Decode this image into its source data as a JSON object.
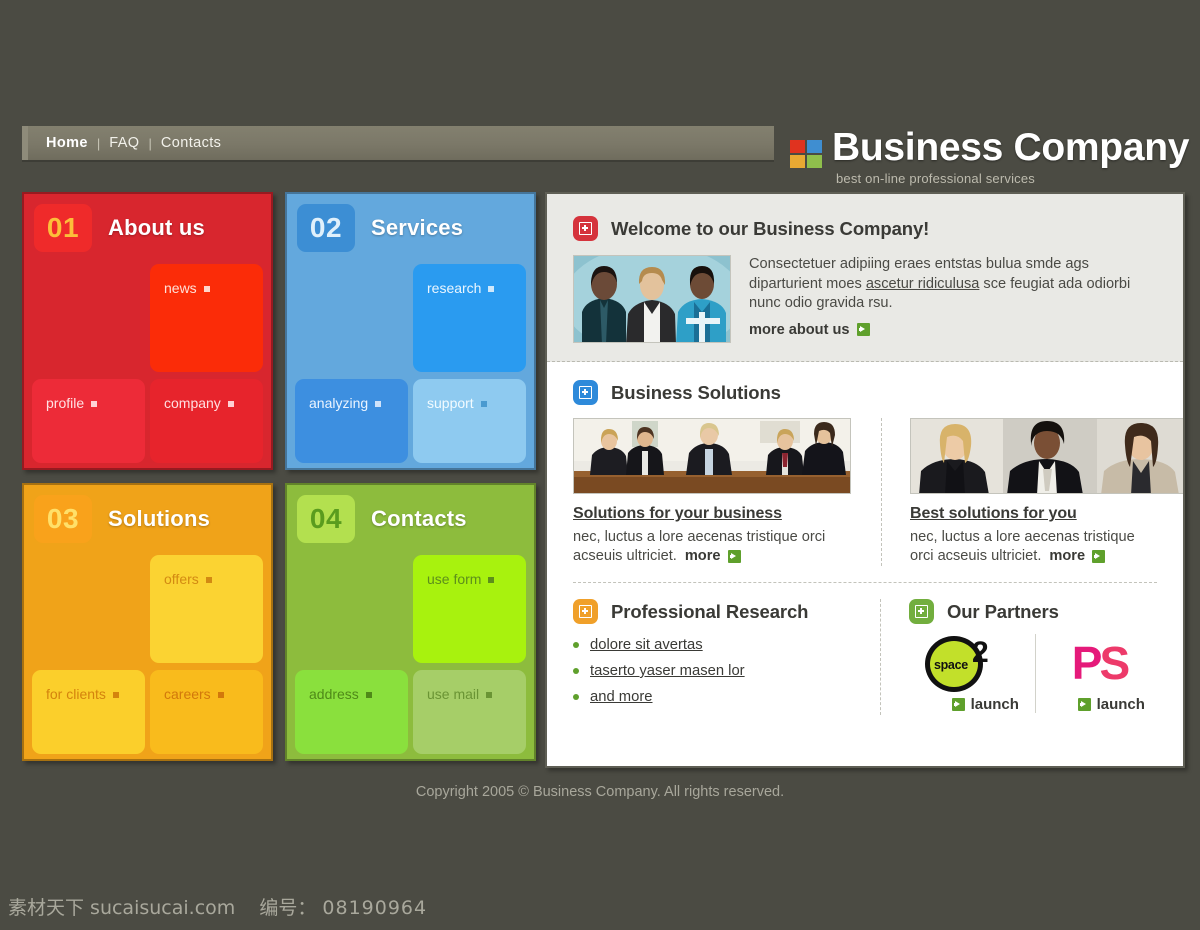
{
  "header": {
    "nav": [
      {
        "label": "Home",
        "active": true
      },
      {
        "label": "FAQ",
        "active": false
      },
      {
        "label": "Contacts",
        "active": false
      }
    ],
    "separator": "|",
    "logo_title": "Business Company",
    "logo_tagline": "best on-line professional services",
    "logo_colors": {
      "top_left": "#e0331f",
      "top_right": "#3f8ed1",
      "bottom_left": "#e9a933",
      "bottom_right": "#8fbf4c"
    }
  },
  "panels": [
    {
      "number": "01",
      "title": "About us",
      "color": "#d8262e",
      "tiles": [
        {
          "label": "news"
        },
        {
          "label": "profile"
        },
        {
          "label": "company"
        }
      ]
    },
    {
      "number": "02",
      "title": "Services",
      "color": "#63a8dd",
      "tiles": [
        {
          "label": "research"
        },
        {
          "label": "analyzing"
        },
        {
          "label": "support"
        }
      ]
    },
    {
      "number": "03",
      "title": "Solutions",
      "color": "#f0a319",
      "tiles": [
        {
          "label": "offers"
        },
        {
          "label": "for clients"
        },
        {
          "label": "careers"
        }
      ]
    },
    {
      "number": "04",
      "title": "Contacts",
      "color": "#8dbc3d",
      "tiles": [
        {
          "label": "use form"
        },
        {
          "label": "address"
        },
        {
          "label": "use mail"
        }
      ]
    }
  ],
  "content": {
    "welcome": {
      "icon": "plus-box-icon",
      "icon_color": "#d5333c",
      "title": "Welcome to our Business Company!",
      "paragraph_before": "Consectetuer adipiing eraes entstas bulua smde ags diparturient moes ",
      "paragraph_link": "ascetur ridiculusa",
      "paragraph_after": " sce feugiat ada odiorbi nunc odio gravida rsu.",
      "more_label": "more about us",
      "photo_alt": "three business people photo"
    },
    "solutions": {
      "icon": "plus-box-icon",
      "icon_color": "#2e8ada",
      "title": "Business Solutions",
      "items": [
        {
          "heading": "Solutions for your business",
          "text": "nec, luctus a lore aecenas tristique orci acseuis ultriciet.",
          "more_label": "more",
          "photo_alt": "business meeting at conference table"
        },
        {
          "heading": "Best solutions for you",
          "text": "nec, luctus a lore aecenas tristique orci acseuis ultriciet.",
          "more_label": "more",
          "photo_alt": "three businesswomen portrait"
        }
      ]
    },
    "research": {
      "icon": "plus-box-icon",
      "icon_color": "#f0a02a",
      "title": "Professional Research",
      "links": [
        "dolore sit avertas",
        "taserto yaser masen lor",
        "and more"
      ]
    },
    "partners": {
      "icon": "plus-box-icon",
      "icon_color": "#72ae3e",
      "title": "Our Partners",
      "items": [
        {
          "logo_name": "space2-logo",
          "logo_word": "space",
          "logo_mark": "2",
          "launch_label": "launch"
        },
        {
          "logo_name": "ps-logo",
          "logo_letters_1": "P",
          "logo_letters_2": "S",
          "launch_label": "launch"
        }
      ]
    }
  },
  "footer": {
    "copyright": "Copyright 2005 © Business Company. All rights reserved."
  },
  "watermark": {
    "site": "素材天下 sucaisucai.com",
    "id_label": "编号：",
    "id_value": "08190964"
  }
}
